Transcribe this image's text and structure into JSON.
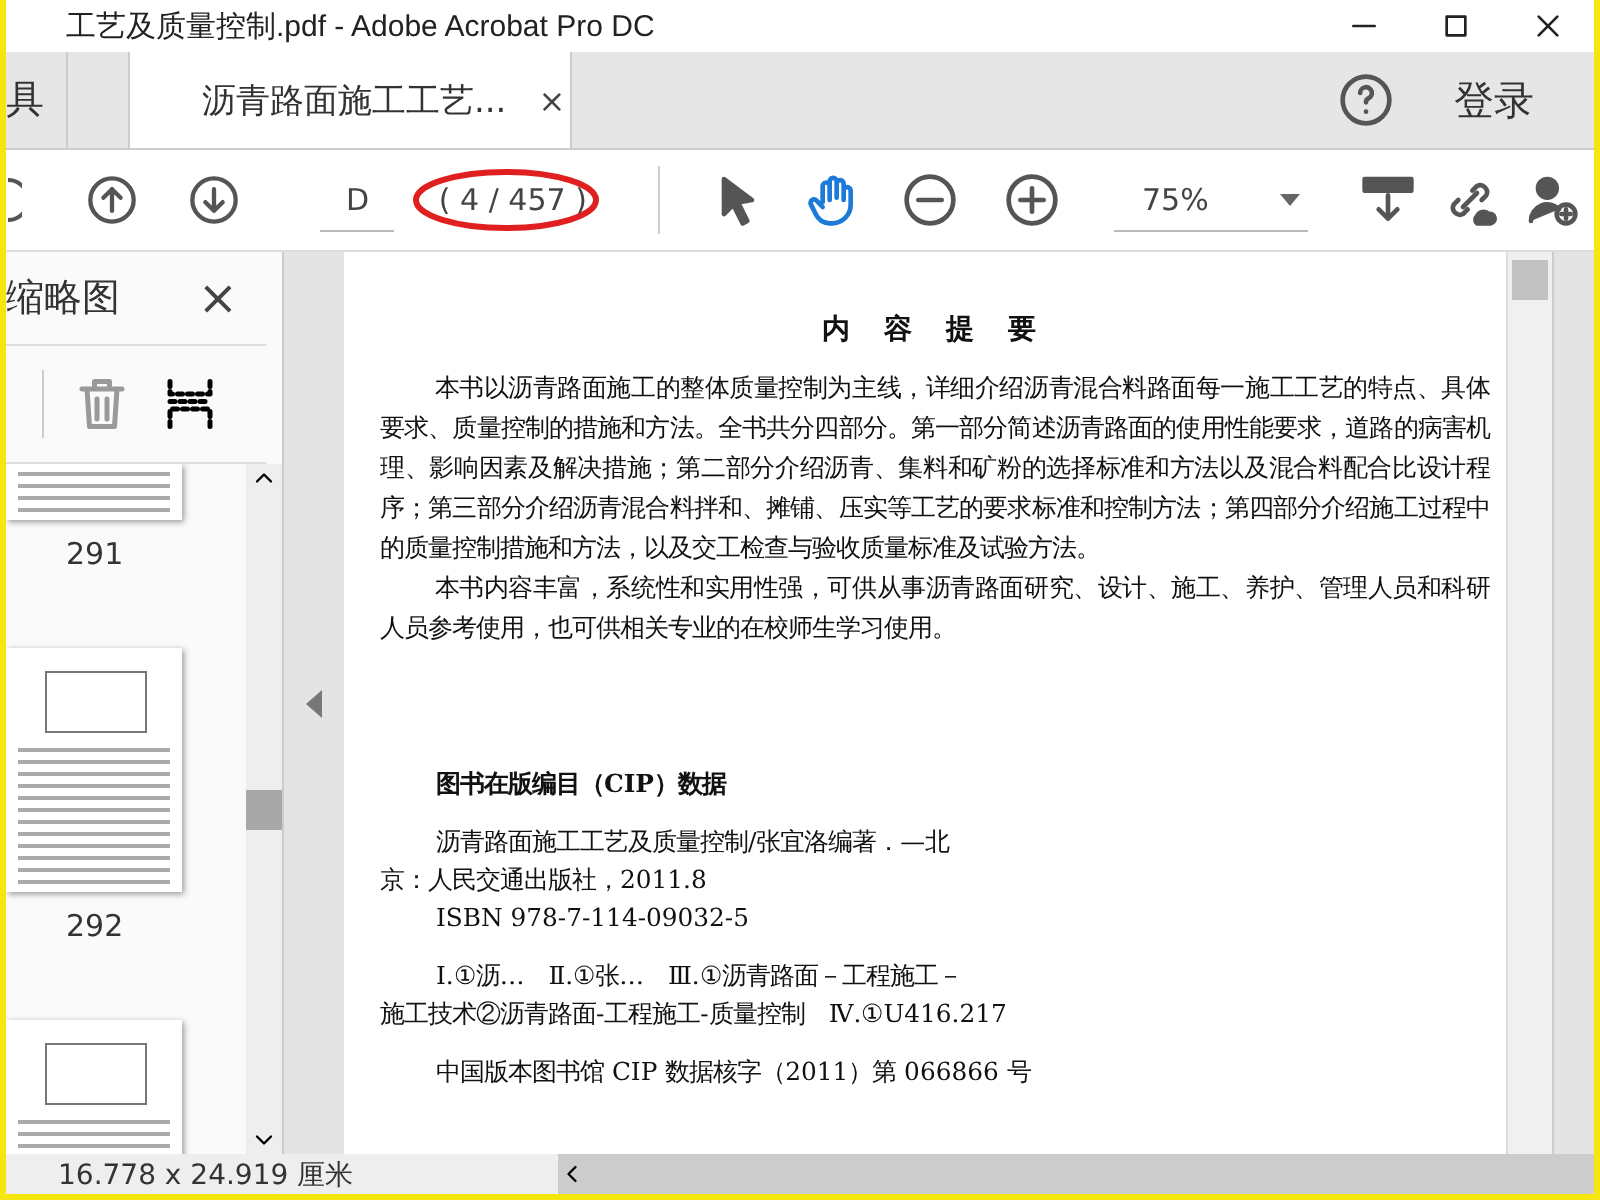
{
  "window": {
    "title": "工艺及质量控制.pdf - Adobe Acrobat Pro DC"
  },
  "tabs": [
    {
      "label": "具",
      "selected": false
    },
    {
      "label": "沥青路面施工工艺...",
      "selected": true,
      "close": "×"
    }
  ],
  "account": {
    "login": "登录"
  },
  "toolbar": {
    "page_field": "D",
    "page_count": "( 4 / 457 )",
    "tools": [
      {
        "kind": "pointer",
        "selected": false
      },
      {
        "kind": "hand",
        "selected": true
      }
    ],
    "zoom": "75%"
  },
  "sidebar": {
    "title": "缩略图",
    "close": "×",
    "thumbnails": [
      {
        "label": "291",
        "kind": "text"
      },
      {
        "label": "292",
        "kind": "figure"
      },
      {
        "kind": "figure"
      }
    ]
  },
  "document": {
    "heading": "内 容 提 要",
    "paragraphs": [
      "本书以沥青路面施工的整体质量控制为主线，详细介绍沥青混合料路面每一施工工艺的特点、具体要求、质量控制的措施和方法。全书共分四部分。第一部分简述沥青路面的使用性能要求，道路的病害机理、影响因素及解决措施；第二部分介绍沥青、集料和矿粉的选择标准和方法以及混合料配合比设计程序；第三部分介绍沥青混合料拌和、摊铺、压实等工艺的要求标准和控制方法；第四部分介绍施工过程中的质量控制措施和方法，以及交工检查与验收质量标准及试验方法。",
      "本书内容丰富，系统性和实用性强，可供从事沥青路面研究、设计、施工、养护、管理人员和科研人员参考使用，也可供相关专业的在校师生学习使用。"
    ],
    "cip_heading": "图书在版编目（CIP）数据",
    "cip_blocks": [
      [
        "沥青路面施工工艺及质量控制/张宜洛编著．—北",
        "京：人民交通出版社，2011.8",
        "ISBN 978-7-114-09032-5"
      ],
      [
        "Ⅰ.①沥…　Ⅱ.①张…　Ⅲ.①沥青路面－工程施工－",
        "施工技术②沥青路面-工程施工-质量控制　Ⅳ.①U416.217"
      ],
      [
        "中国版本图书馆 CIP 数据核字（2011）第 066866 号"
      ]
    ]
  },
  "status_bar": {
    "page_size": "16.778 x 24.919 厘米"
  }
}
